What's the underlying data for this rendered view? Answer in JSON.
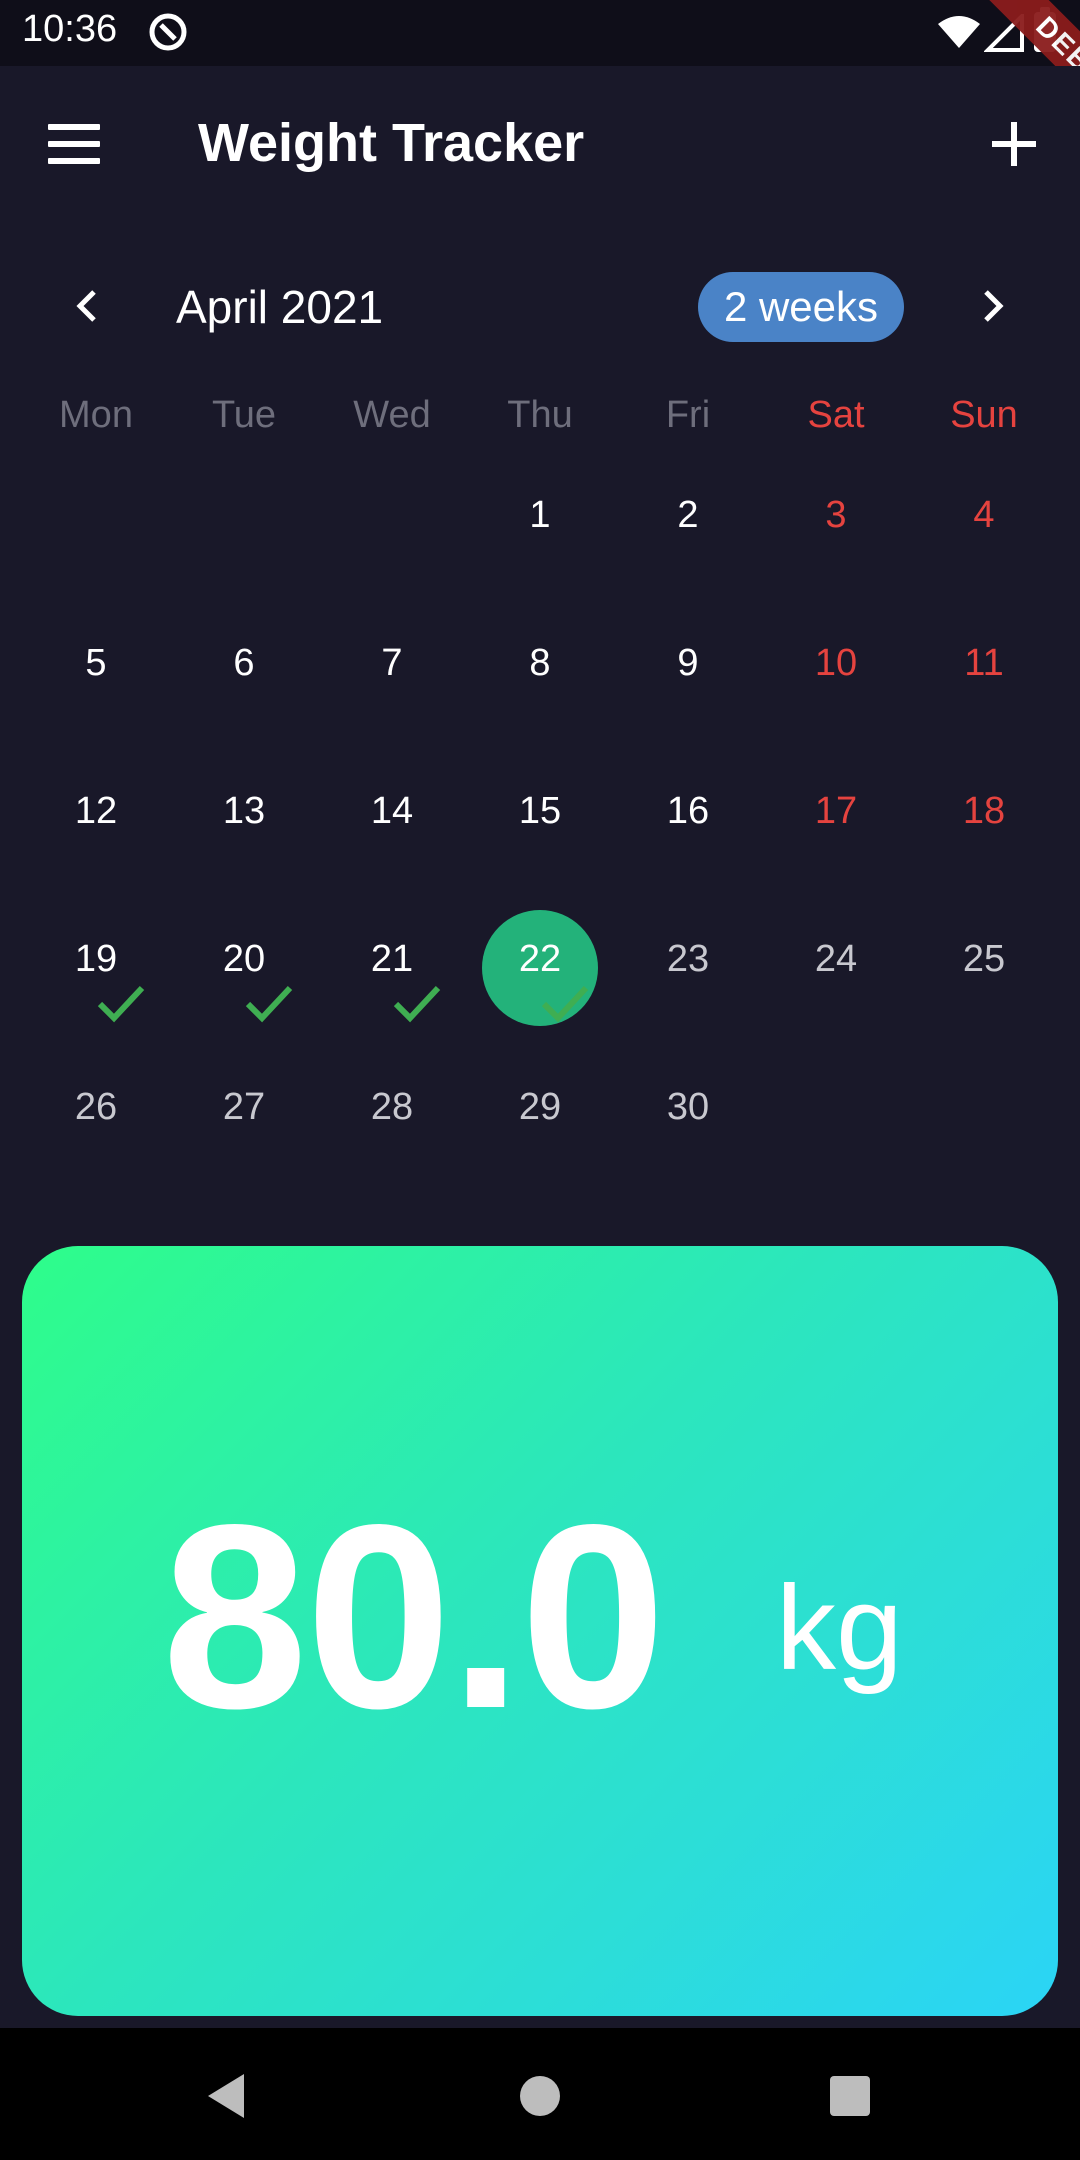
{
  "status_bar": {
    "time": "10:36",
    "debug_label": "DEBUG"
  },
  "app_bar": {
    "title": "Weight Tracker",
    "menu_icon": "menu-icon",
    "add_icon": "add-icon"
  },
  "calendar": {
    "month_label": "April 2021",
    "format_button": "2 weeks",
    "weekdays": [
      "Mon",
      "Tue",
      "Wed",
      "Thu",
      "Fri",
      "Sat",
      "Sun"
    ],
    "weeks": [
      [
        "",
        "",
        "",
        "1",
        "2",
        "3",
        "4"
      ],
      [
        "5",
        "6",
        "7",
        "8",
        "9",
        "10",
        "11"
      ],
      [
        "12",
        "13",
        "14",
        "15",
        "16",
        "17",
        "18"
      ],
      [
        "19",
        "20",
        "21",
        "22",
        "23",
        "24",
        "25"
      ],
      [
        "26",
        "27",
        "28",
        "29",
        "30",
        "",
        ""
      ]
    ],
    "selected_day": "22",
    "checked_days": [
      "19",
      "20",
      "21",
      "22"
    ],
    "colors": {
      "weekday": "#6e6e7c",
      "weekend": "#e5433f",
      "past_day": "#ffffff",
      "future_day": "#c8c8cf",
      "selected_bg": "#23b27a",
      "check": "#3fae52"
    }
  },
  "weight_card": {
    "value": "80.0",
    "unit": "kg",
    "gradient": [
      "#2efd8a",
      "#2bd4f6"
    ]
  },
  "nav_bar": {
    "back_icon": "back-triangle-icon",
    "home_icon": "home-circle-icon",
    "recent_icon": "recent-square-icon"
  }
}
